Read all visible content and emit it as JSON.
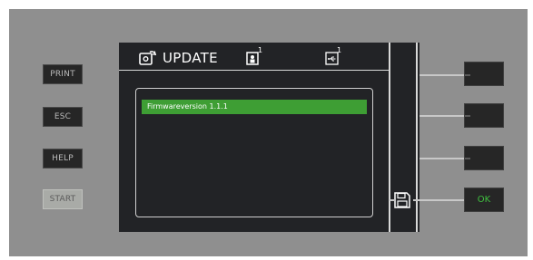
{
  "left_buttons": {
    "print_label": "PRINT",
    "esc_label": "ESC",
    "help_label": "HELP",
    "start_label": "START"
  },
  "screen": {
    "title": "UPDATE",
    "header_icons": [
      "update-icon",
      "person-slot-icon",
      "usb-slot-icon"
    ],
    "person_badge": "1",
    "usb_badge": "1",
    "firmware_item": "Firmwareversion 1.1.1",
    "side_icon": "save-icon"
  },
  "right_buttons": {
    "softkey_1_label": "",
    "softkey_2_label": "",
    "softkey_3_label": "",
    "ok_label": "OK"
  },
  "colors": {
    "panel": "#8f8f8f",
    "screen": "#222326",
    "highlight": "#3e9e34",
    "ok_text": "#3fbf3f"
  }
}
